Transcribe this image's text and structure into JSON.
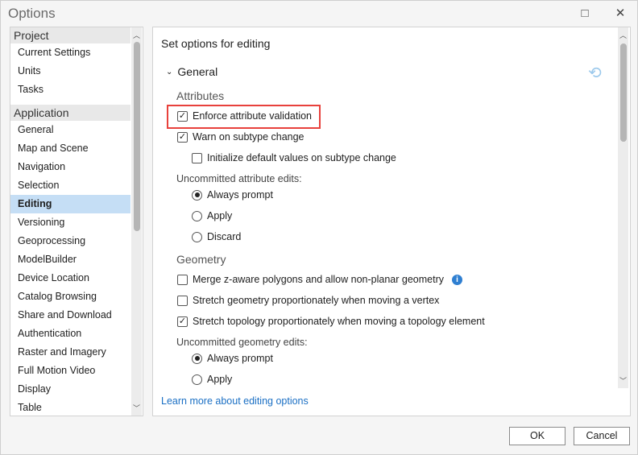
{
  "window": {
    "title": "Options",
    "maximize_icon": "□",
    "close_icon": "✕"
  },
  "sidebar": {
    "groups": [
      {
        "label": "Project"
      },
      {
        "label": "Application"
      }
    ],
    "project_items": [
      "Current Settings",
      "Units",
      "Tasks"
    ],
    "application_items": [
      "General",
      "Map and Scene",
      "Navigation",
      "Selection",
      "Editing",
      "Versioning",
      "Geoprocessing",
      "ModelBuilder",
      "Device Location",
      "Catalog Browsing",
      "Share and Download",
      "Authentication",
      "Raster and Imagery",
      "Full Motion Video",
      "Display",
      "Table"
    ],
    "selected": "Editing"
  },
  "main": {
    "heading": "Set options for editing",
    "general_label": "General",
    "attributes_label": "Attributes",
    "enforce": "Enforce attribute validation",
    "warn_subtype": "Warn on subtype change",
    "init_defaults": "Initialize default values on subtype change",
    "uncommitted_attr": "Uncommitted attribute edits:",
    "attr_opts": [
      "Always prompt",
      "Apply",
      "Discard"
    ],
    "geometry_label": "Geometry",
    "merge_z": "Merge z-aware polygons and allow non-planar geometry",
    "stretch_geom": "Stretch geometry proportionately when moving a vertex",
    "stretch_topo": "Stretch topology proportionately when moving a topology element",
    "uncommitted_geom": "Uncommitted geometry edits:",
    "geom_opts": [
      "Always prompt",
      "Apply"
    ],
    "learn_more": "Learn more about editing options",
    "check": "✓",
    "highlight_color": "#e8413c"
  },
  "footer": {
    "ok": "OK",
    "cancel": "Cancel"
  }
}
